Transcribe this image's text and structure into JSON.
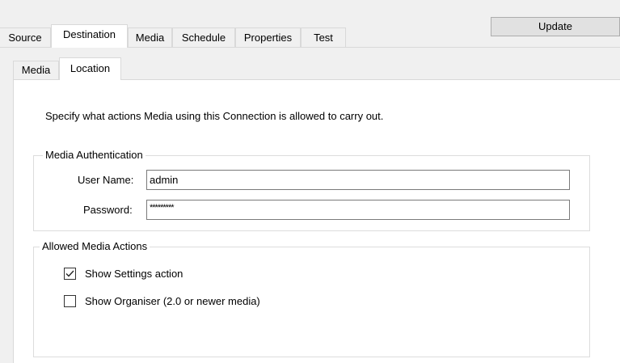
{
  "tabs": [
    {
      "label": "Source",
      "active": false
    },
    {
      "label": "Destination",
      "active": true
    },
    {
      "label": "Media",
      "active": false
    },
    {
      "label": "Schedule",
      "active": false
    },
    {
      "label": "Properties",
      "active": false
    },
    {
      "label": "Test",
      "active": false
    }
  ],
  "update_button": {
    "label": "Update"
  },
  "inner_tabs": [
    {
      "label": "Media",
      "active": false
    },
    {
      "label": "Location",
      "active": true
    }
  ],
  "description": "Specify what actions Media using this Connection is allowed to carry out.",
  "auth_group": {
    "legend": "Media Authentication",
    "user_name_label": "User Name:",
    "user_name_value": "admin",
    "password_label": "Password:",
    "password_value": "*********"
  },
  "actions_group": {
    "legend": "Allowed Media Actions",
    "options": [
      {
        "label": "Show Settings action",
        "checked": true
      },
      {
        "label": "Show Organiser (2.0 or newer media)",
        "checked": false
      }
    ]
  }
}
